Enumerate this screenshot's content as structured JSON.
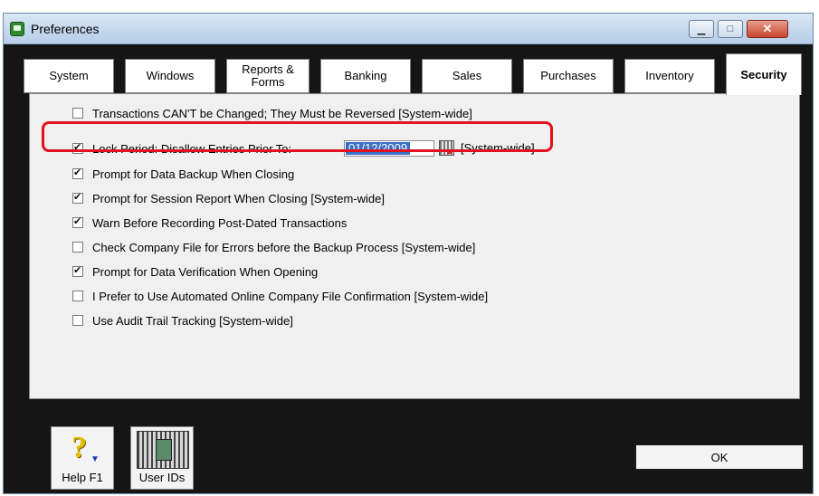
{
  "window": {
    "title": "Preferences",
    "controls": {
      "minimize": "▁",
      "maximize": "□",
      "close": "✕"
    }
  },
  "tabs": [
    {
      "label": "System"
    },
    {
      "label": "Windows"
    },
    {
      "label": "Reports & Forms"
    },
    {
      "label": "Banking"
    },
    {
      "label": "Sales"
    },
    {
      "label": "Purchases"
    },
    {
      "label": "Inventory"
    },
    {
      "label": "Security",
      "active": true
    }
  ],
  "options": [
    {
      "label": "Transactions CAN'T be Changed; They Must be Reversed [System-wide]",
      "checked": false
    },
    {
      "label": "Lock Period: Disallow Entries Prior To:",
      "checked": true
    },
    {
      "label": "Prompt for Data Backup When Closing",
      "checked": true
    },
    {
      "label": "Prompt for Session Report When Closing [System-wide]",
      "checked": true
    },
    {
      "label": "Warn Before Recording Post-Dated Transactions",
      "checked": true
    },
    {
      "label": "Check Company File for Errors before the Backup Process [System-wide]",
      "checked": false
    },
    {
      "label": "Prompt for Data Verification When Opening",
      "checked": true
    },
    {
      "label": "I Prefer to Use Automated Online Company File Confirmation [System-wide]",
      "checked": false
    },
    {
      "label": "Use Audit Trail Tracking [System-wide]",
      "checked": false
    }
  ],
  "lock_period": {
    "date": "01/12/2009",
    "scope": "[System-wide]"
  },
  "buttons": {
    "help": "Help F1",
    "user_ids": "User IDs",
    "ok": "OK"
  },
  "colors": {
    "highlight": "#e3101e",
    "date_selection": "#3a70c8"
  },
  "icons": {
    "help": "question-mark-icon",
    "user_ids": "users-id-icon",
    "calendar": "calendar-icon"
  }
}
